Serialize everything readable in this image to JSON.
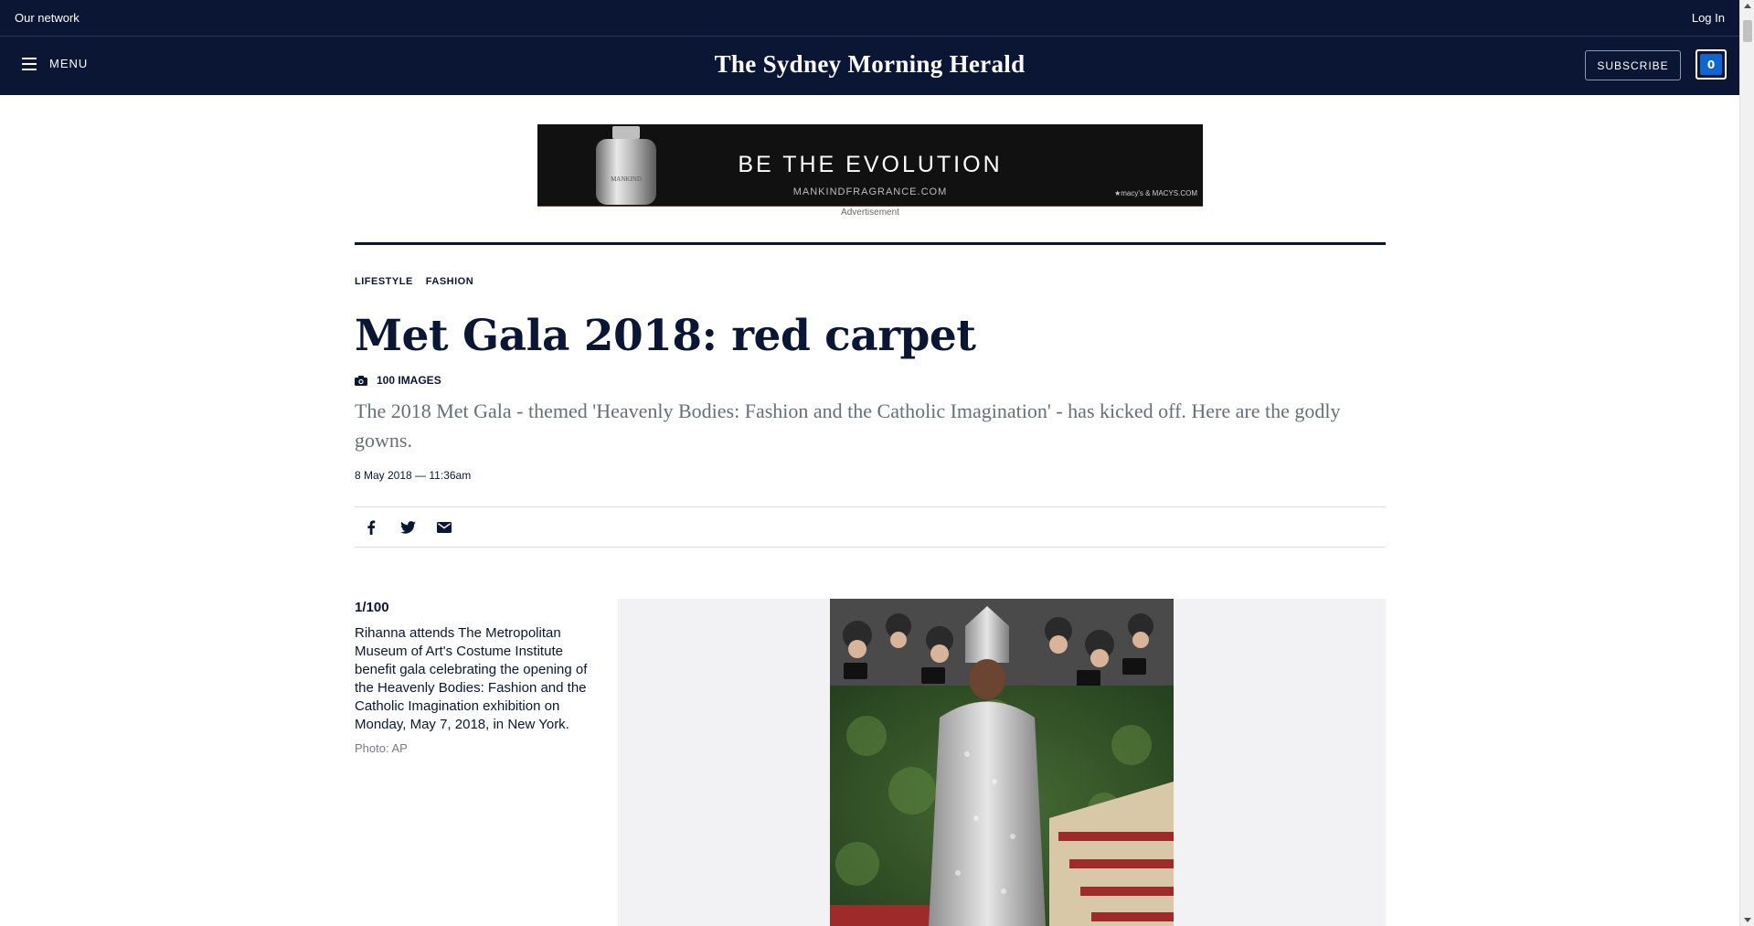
{
  "topbar": {
    "network": "Our network",
    "login": "Log In"
  },
  "masthead": {
    "menu": "MENU",
    "logo": "The Sydney Morning Herald",
    "subscribe": "SUBSCRIBE",
    "counter": "0"
  },
  "ad": {
    "headline": "BE THE EVOLUTION",
    "sub": "MANKINDFRAGRANCE.COM",
    "retail": "★macy's & MACYS.COM",
    "bottle_text": "MANKIND",
    "label": "Advertisement"
  },
  "article": {
    "categories": [
      "LIFESTYLE",
      "FASHION"
    ],
    "title": "Met Gala 2018: red carpet",
    "images_count": "100 IMAGES",
    "standfirst": "The 2018 Met Gala - themed 'Heavenly Bodies: Fashion and the Catholic Imagination' - has kicked off. Here are the godly gowns.",
    "dateline": "8 May 2018 — 11:36am"
  },
  "share": {
    "icons": [
      "facebook-icon",
      "twitter-icon",
      "email-icon"
    ]
  },
  "gallery": {
    "position": "1/100",
    "caption": "Rihanna attends The Metropolitan Museum of Art's Costume Institute benefit gala celebrating the opening of the Heavenly Bodies: Fashion and the Catholic Imagination exhibition on Monday, May 7, 2018, in New York.",
    "credit": "Photo: AP"
  },
  "colors": {
    "navy": "#0a1633",
    "accent": "#1066d1",
    "muted": "#666e7a"
  }
}
